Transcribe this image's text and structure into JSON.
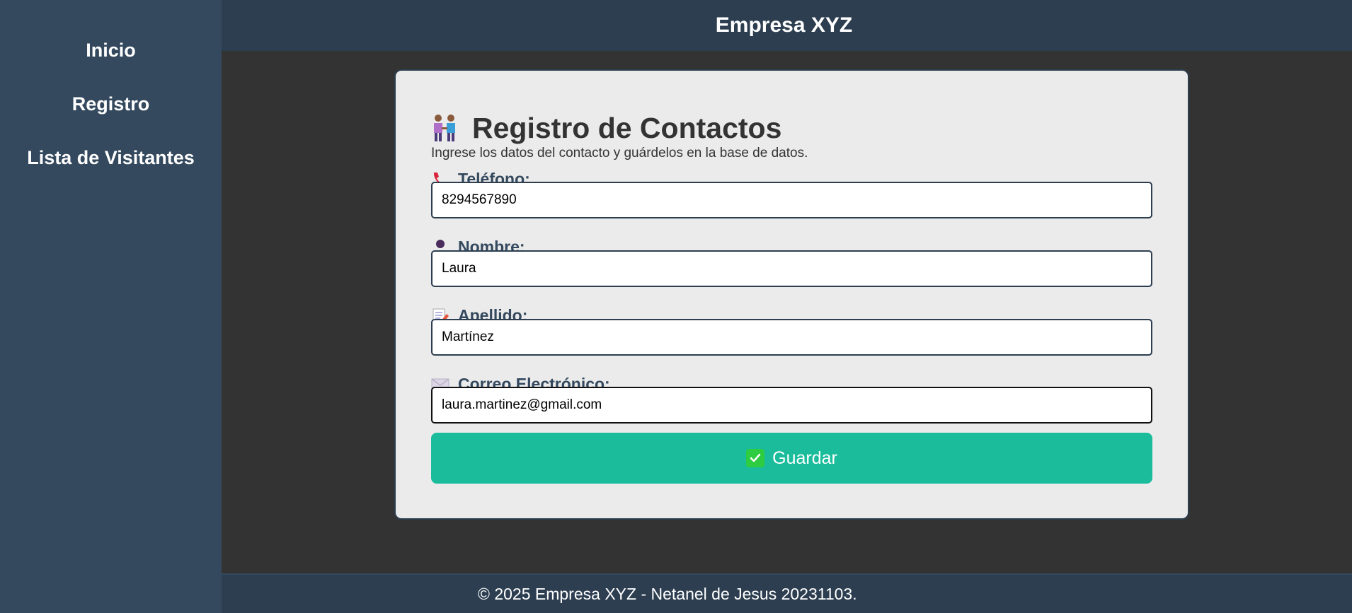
{
  "header": {
    "title": "Empresa XYZ"
  },
  "sidebar": {
    "items": [
      {
        "label": "Inicio"
      },
      {
        "label": "Registro"
      },
      {
        "label": "Lista de Visitantes"
      }
    ]
  },
  "form": {
    "title": "Registro de Contactos",
    "subtitle": "Ingrese los datos del contacto y guárdelos en la base de datos.",
    "fields": [
      {
        "label": "Teléfono:",
        "value": "8294567890",
        "icon": "telephone-icon"
      },
      {
        "label": "Nombre:",
        "value": "Laura",
        "icon": "person-icon"
      },
      {
        "label": "Apellido:",
        "value": "Martínez",
        "icon": "memo-icon"
      },
      {
        "label": "Correo Electrónico:",
        "value": "laura.martinez@gmail.com",
        "icon": "envelope-icon"
      }
    ],
    "save_label": "Guardar"
  },
  "footer": {
    "text": "© 2025 Empresa XYZ - Netanel de Jesus 20231103."
  },
  "colors": {
    "sidebar_bg": "#34495e",
    "header_bg": "#2c3e50",
    "main_bg": "#333333",
    "card_bg": "#ebebeb",
    "accent": "#1abc9c"
  }
}
